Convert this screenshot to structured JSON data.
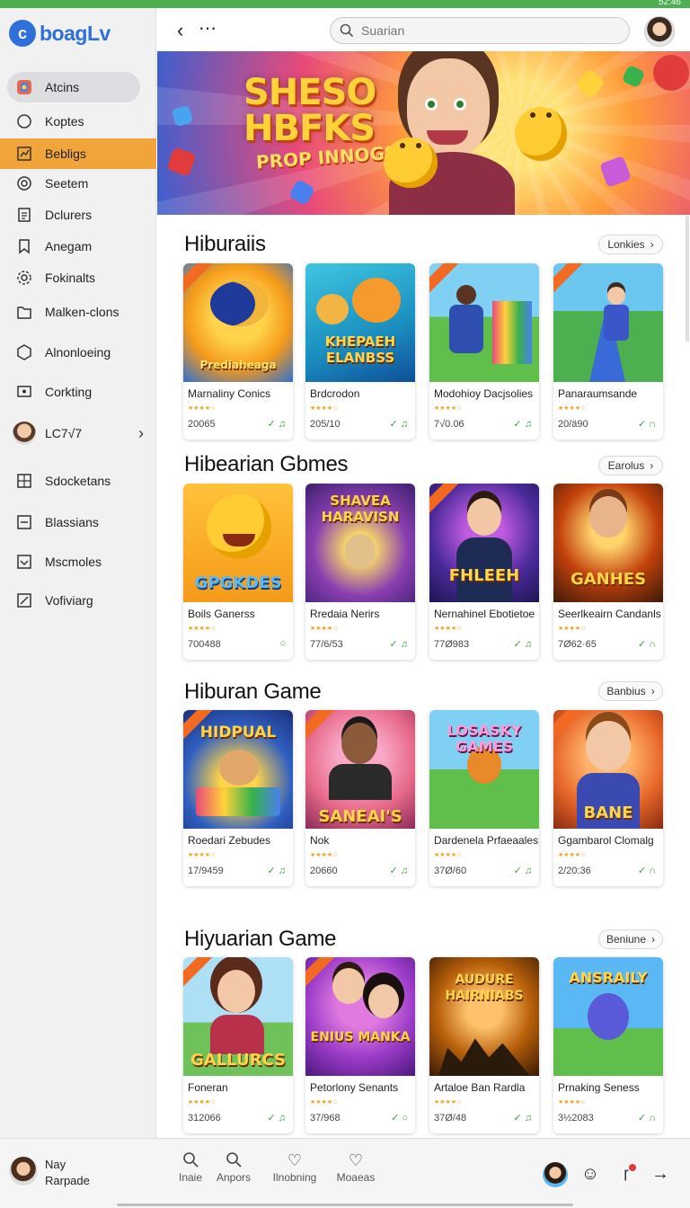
{
  "status": {
    "time": "52:46"
  },
  "app": {
    "logo_text": "boagLv"
  },
  "sidebar": {
    "items": [
      {
        "label": "Atcins",
        "icon": "app-grid-icon"
      },
      {
        "label": "Koptes",
        "icon": "circle-icon"
      },
      {
        "label": "Bebligs",
        "icon": "chart-icon"
      },
      {
        "label": "Seetem",
        "icon": "target-icon"
      },
      {
        "label": "Dclurers",
        "icon": "document-icon"
      },
      {
        "label": "Anegam",
        "icon": "bookmark-icon"
      },
      {
        "label": "Fokinalts",
        "icon": "gear-icon"
      },
      {
        "label": "Malken-clons",
        "icon": "folder-icon"
      },
      {
        "label": "Alnonloeing",
        "icon": "hexagon-icon"
      },
      {
        "label": "Corkting",
        "icon": "chat-icon"
      },
      {
        "label": "LC7√7",
        "icon": "avatar"
      },
      {
        "label": "Sdocketans",
        "icon": "grid-icon"
      },
      {
        "label": "Blassians",
        "icon": "list-icon"
      },
      {
        "label": "Mscmoles",
        "icon": "inbox-icon"
      },
      {
        "label": "Vofiviarg",
        "icon": "edit-icon"
      }
    ]
  },
  "search": {
    "placeholder": "Suarian"
  },
  "banner": {
    "title_line1": "SHESO",
    "title_line2": "HBFKS",
    "subtitle": "PROP INNOGS"
  },
  "sections": [
    {
      "title": "Hiburaiis",
      "more_label": "Lonkies",
      "cards": [
        {
          "name": "Marnaliny Conics",
          "count": "20065",
          "thumb_text": "Prediaheaga"
        },
        {
          "name": "Brdcrodon",
          "count": "205/10",
          "thumb_text": "KHEPAEH ELANBSS"
        },
        {
          "name": "Modohioy Dacjsolies",
          "count": "7√0.06",
          "thumb_text": ""
        },
        {
          "name": "Panaraumsande",
          "count": "20/ä90",
          "thumb_text": ""
        }
      ]
    },
    {
      "title": "Hibearian Gbmes",
      "more_label": "Earolus",
      "cards": [
        {
          "name": "Boils Ganerss",
          "count": "700488",
          "thumb_text": "GPGKDES"
        },
        {
          "name": "Rredaia Nerirs",
          "count": "77/6/53",
          "thumb_text": "SHAVEA HARAVISN"
        },
        {
          "name": "Nernahinel Ebotietoe",
          "count": "77Ø983",
          "thumb_text": "FHLEEH"
        },
        {
          "name": "Seerlkeairn Candanls",
          "count": "7Ø62·65",
          "thumb_text": "GANHES"
        }
      ]
    },
    {
      "title": "Hiburan Game",
      "more_label": "Banbius",
      "cards": [
        {
          "name": "Roedari Zebudes",
          "count": "17/9459",
          "thumb_text": "HIDPUAL"
        },
        {
          "name": "Nok",
          "count": "20660",
          "thumb_text": "SANEAI'S"
        },
        {
          "name": "Dardenela Prfaeaales",
          "count": "37Ø/60",
          "thumb_text": "LOSASKY GAMES"
        },
        {
          "name": "Ggambarol Clomalg",
          "count": "2/20:36",
          "thumb_text": "BANE"
        }
      ]
    },
    {
      "title": "Hiyuarian Game",
      "more_label": "Beniune",
      "cards": [
        {
          "name": "Foneran",
          "count": "312066",
          "thumb_text": "GALLURCS"
        },
        {
          "name": "Petorlony Senants",
          "count": "37/968",
          "thumb_text": "ENIUS MANKA"
        },
        {
          "name": "Artaloe Ban Rardla",
          "count": "37Ø/48",
          "thumb_text": "AUDURE HAIRNIABS"
        },
        {
          "name": "Prnaking Seness",
          "count": "3½2083",
          "thumb_text": "ANSRAILY"
        }
      ]
    }
  ],
  "bottom": {
    "user_line1": "Nay",
    "user_line2": "Rarpade",
    "nav": [
      {
        "label": "Inaie",
        "icon": "search-icon"
      },
      {
        "label": "Anpors",
        "icon": "search-icon"
      },
      {
        "label": "Ilnobning",
        "icon": "heart-icon"
      },
      {
        "label": "Moaeas",
        "icon": "heart-icon"
      }
    ]
  },
  "colors": {
    "accent": "#f0a43a",
    "brand": "#2e6fd9",
    "status_bar": "#4caf50"
  }
}
